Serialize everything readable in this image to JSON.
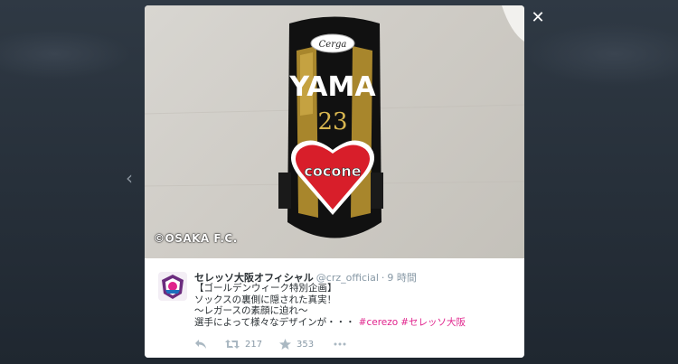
{
  "viewer": {
    "close_symbol": "✕",
    "prev_symbol": "‹"
  },
  "media": {
    "overlay_text": "©OSAKA F.C.",
    "shinguard": {
      "logo_text": "Cerga",
      "name_text": "YAMA",
      "number_text": "23",
      "heart_text": "cocone"
    }
  },
  "tweet": {
    "display_name": "セレッソ大阪オフィシャル",
    "handle": "@crz_official",
    "separator": "·",
    "time": "9 時間",
    "lines": [
      "【ゴールデンウィーク特別企画】",
      "ソックスの裏側に隠された真実！",
      "～レガースの素顔に迫れ～",
      "選手によって様々なデザインが・・・"
    ],
    "hashtags": [
      "#cerezo",
      "#セレッソ大阪"
    ],
    "actions": {
      "retweet_count": "217",
      "favorite_count": "353"
    }
  },
  "colors": {
    "hashtag": "#e0238c",
    "muted": "#8899a6",
    "text": "#292f33"
  },
  "icons": {
    "close": "close-icon",
    "prev": "chevron-left-icon",
    "reply": "reply-icon",
    "retweet": "retweet-icon",
    "favorite": "star-icon",
    "more": "more-icon"
  }
}
